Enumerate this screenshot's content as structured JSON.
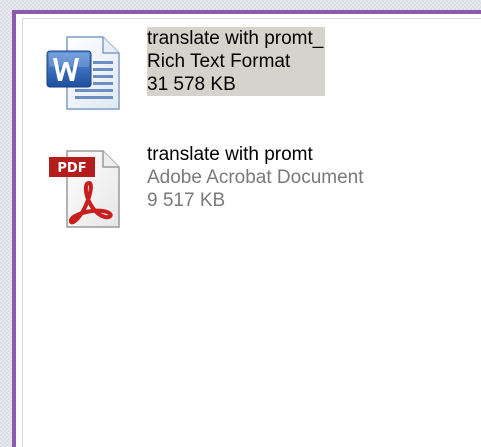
{
  "colors": {
    "window_border": "#8b5aa8",
    "selection_bg": "#d6d3cc",
    "dim_text": "#7a7a7a"
  },
  "files": [
    {
      "icon": "word-document-icon",
      "name": "translate with promt_",
      "type": "Rich Text Format",
      "size": "31 578 KB",
      "selected": true
    },
    {
      "icon": "pdf-document-icon",
      "name": "translate with promt",
      "type": "Adobe Acrobat Document",
      "size": "9 517 KB",
      "selected": false
    }
  ]
}
